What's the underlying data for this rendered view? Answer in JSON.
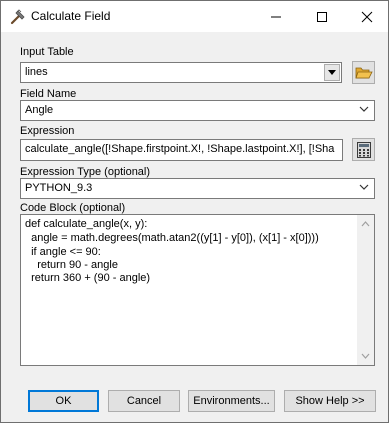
{
  "window": {
    "title": "Calculate Field"
  },
  "input_table": {
    "label": "Input Table",
    "value": "lines"
  },
  "field_name": {
    "label": "Field Name",
    "value": "Angle"
  },
  "expression": {
    "label": "Expression",
    "value": "calculate_angle([!Shape.firstpoint.X!, !Shape.lastpoint.X!], [!Sha"
  },
  "expression_type": {
    "label": "Expression Type (optional)",
    "value": "PYTHON_9.3"
  },
  "code_block": {
    "label": "Code Block (optional)",
    "lines": [
      "def calculate_angle(x, y):",
      "  angle = math.degrees(math.atan2((y[1] - y[0]), (x[1] - x[0])))",
      "  if angle <= 90:",
      "    return 90 - angle",
      "  return 360 + (90 - angle)"
    ]
  },
  "buttons": {
    "ok": "OK",
    "cancel": "Cancel",
    "environments": "Environments...",
    "show_help": "Show Help >>"
  },
  "icons": {
    "title": "hammer-icon",
    "browse": "folder-open-icon",
    "calculator": "calculator-icon"
  },
  "colors": {
    "default_button_border": "#0078d7",
    "folder_yellow": "#f2c14e"
  }
}
